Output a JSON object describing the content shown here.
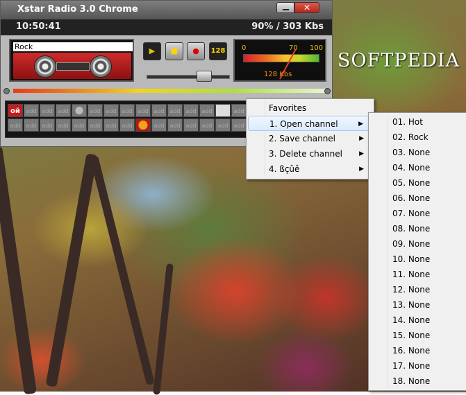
{
  "window": {
    "title": "Xstar Radio 3.0 Chrome",
    "min_icon": "minimize-icon",
    "close_icon": "✕"
  },
  "info": {
    "clock": "10:50:41",
    "status": "90% / 303 Kbs"
  },
  "deck": {
    "station_name": "Rock"
  },
  "controls": {
    "play_icon": "▶",
    "stop_icon": "■",
    "record_icon": "●",
    "bitrate_label": "128"
  },
  "meter": {
    "tick0": "0",
    "tick70": "70",
    "tick100": "100",
    "kbs": "128 Kbs",
    "level_percent": 70
  },
  "volume": {
    "level": 0.7
  },
  "watermark": "SOFTPEDIA",
  "channels": {
    "empty_label": "add",
    "rock_label": "οй"
  },
  "menu": {
    "header": "Favorites",
    "items": [
      {
        "label": "1.  Open channel"
      },
      {
        "label": "2.  Save channel"
      },
      {
        "label": "3.  Delete channel"
      },
      {
        "label": "4.  ßçûê"
      }
    ],
    "arrow": "▶"
  },
  "submenu": {
    "items": [
      "01.  Hot",
      "02.  Rock",
      "03.  None",
      "04.  None",
      "05.  None",
      "06.  None",
      "07.  None",
      "08.  None",
      "09.  None",
      "10.  None",
      "11.  None",
      "12.  None",
      "13.  None",
      "14.  None",
      "15.  None",
      "16.  None",
      "17.  None",
      "18.  None"
    ]
  },
  "colors": {
    "accent_red": "#c41c1c",
    "meter_yellow": "#e8c000",
    "menu_bg": "#f0f0f0"
  }
}
